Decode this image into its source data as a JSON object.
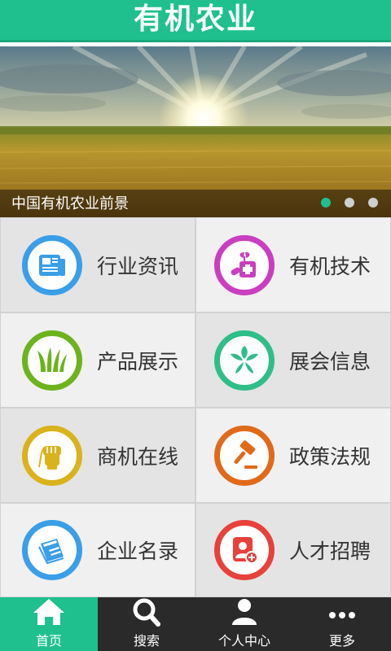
{
  "header": {
    "title": "有机农业"
  },
  "banner": {
    "caption": "中国有机农业前景",
    "dots": 3,
    "active_dot": 0
  },
  "menu": [
    {
      "label": "行业资讯",
      "icon": "newspaper-icon",
      "color": "#3a9ee8"
    },
    {
      "label": "有机技术",
      "icon": "plant-medicine-icon",
      "color": "#c93fbf"
    },
    {
      "label": "产品展示",
      "icon": "grass-icon",
      "color": "#6cb31d"
    },
    {
      "label": "展会信息",
      "icon": "leaf-flower-icon",
      "color": "#2fbe88"
    },
    {
      "label": "商机在线",
      "icon": "fist-wheat-icon",
      "color": "#d9b21c"
    },
    {
      "label": "政策法规",
      "icon": "gavel-icon",
      "color": "#e06a1a"
    },
    {
      "label": "企业名录",
      "icon": "book-icon",
      "color": "#3a9ee8"
    },
    {
      "label": "人才招聘",
      "icon": "add-user-icon",
      "color": "#e8403a"
    }
  ],
  "tabbar": [
    {
      "label": "首页",
      "icon": "home-icon",
      "active": true
    },
    {
      "label": "搜索",
      "icon": "search-icon",
      "active": false
    },
    {
      "label": "个人中心",
      "icon": "user-icon",
      "active": false
    },
    {
      "label": "更多",
      "icon": "more-icon",
      "active": false
    }
  ],
  "colors": {
    "accent": "#1fc08e",
    "tabbar_bg": "#2a2a2a"
  }
}
